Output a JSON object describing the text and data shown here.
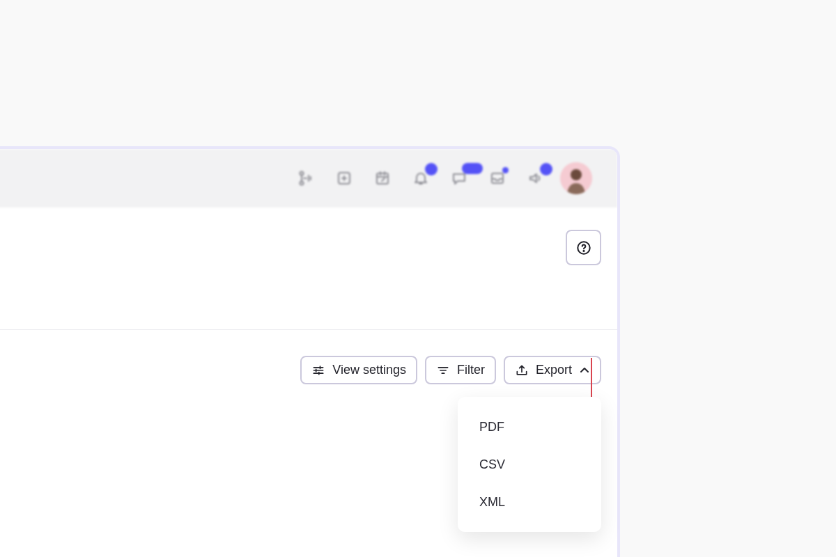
{
  "top_bar": {
    "icons": [
      {
        "kind": "branch"
      },
      {
        "kind": "plus-square"
      },
      {
        "kind": "calendar"
      },
      {
        "kind": "bell",
        "badge": {
          "kind": "round"
        }
      },
      {
        "kind": "chat",
        "badge": {
          "kind": "wide"
        }
      },
      {
        "kind": "inbox",
        "badge": {
          "kind": "small"
        }
      },
      {
        "kind": "speaker",
        "badge": {
          "kind": "round"
        }
      }
    ]
  },
  "toolbar": {
    "buttons": [
      {
        "kind": "sliders",
        "label": "View settings"
      },
      {
        "kind": "filter",
        "label": "Filter"
      },
      {
        "kind": "upload",
        "label": "Export",
        "expanded": true
      }
    ]
  },
  "export_menu": {
    "items": [
      {
        "label": "PDF"
      },
      {
        "label": "CSV"
      },
      {
        "label": "XML"
      }
    ]
  }
}
